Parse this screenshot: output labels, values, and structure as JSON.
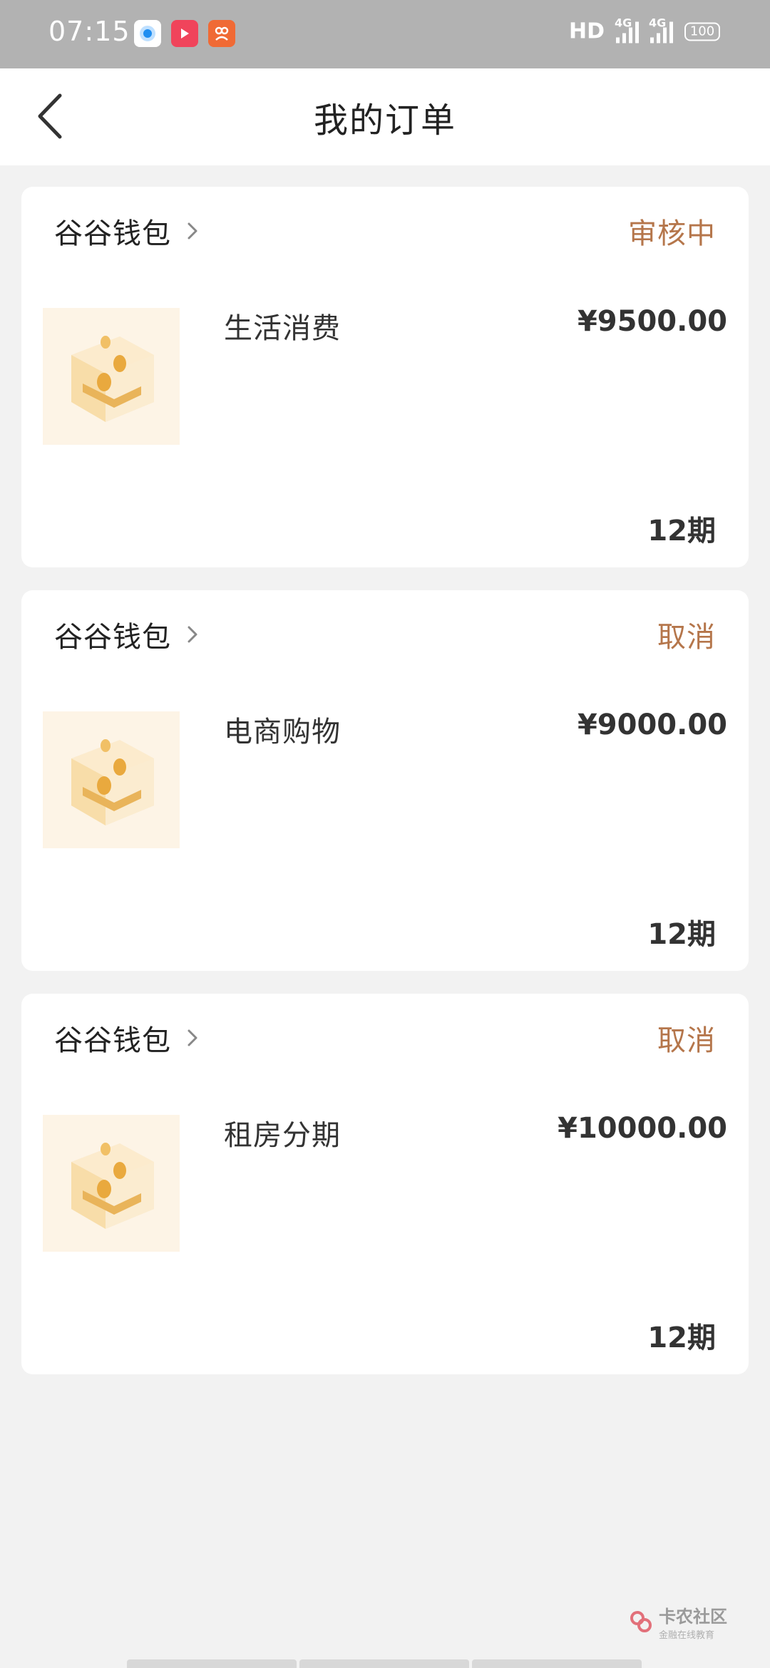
{
  "status_bar": {
    "time": "07:15",
    "hd": "HD",
    "network_1": "4G",
    "network_2": "4G",
    "battery": "100",
    "apps": [
      "browser-app-icon",
      "video-app-icon",
      "social-app-icon"
    ]
  },
  "header": {
    "title": "我的订单",
    "back_icon": "chevron-left-icon"
  },
  "orders": [
    {
      "merchant": "谷谷钱包",
      "status": "审核中",
      "product": "生活消费",
      "price": "¥9500.00",
      "period": "12期"
    },
    {
      "merchant": "谷谷钱包",
      "status": "取消",
      "product": "电商购物",
      "price": "¥9000.00",
      "period": "12期"
    },
    {
      "merchant": "谷谷钱包",
      "status": "取消",
      "product": "租房分期",
      "price": "¥10000.00",
      "period": "12期"
    }
  ],
  "watermark": {
    "title": "卡农社区",
    "subtitle": "金融在线教育"
  },
  "colors": {
    "status_accent": "#b5764b",
    "status_bar_bg": "#b2b2b2",
    "page_bg": "#f2f2f2"
  }
}
